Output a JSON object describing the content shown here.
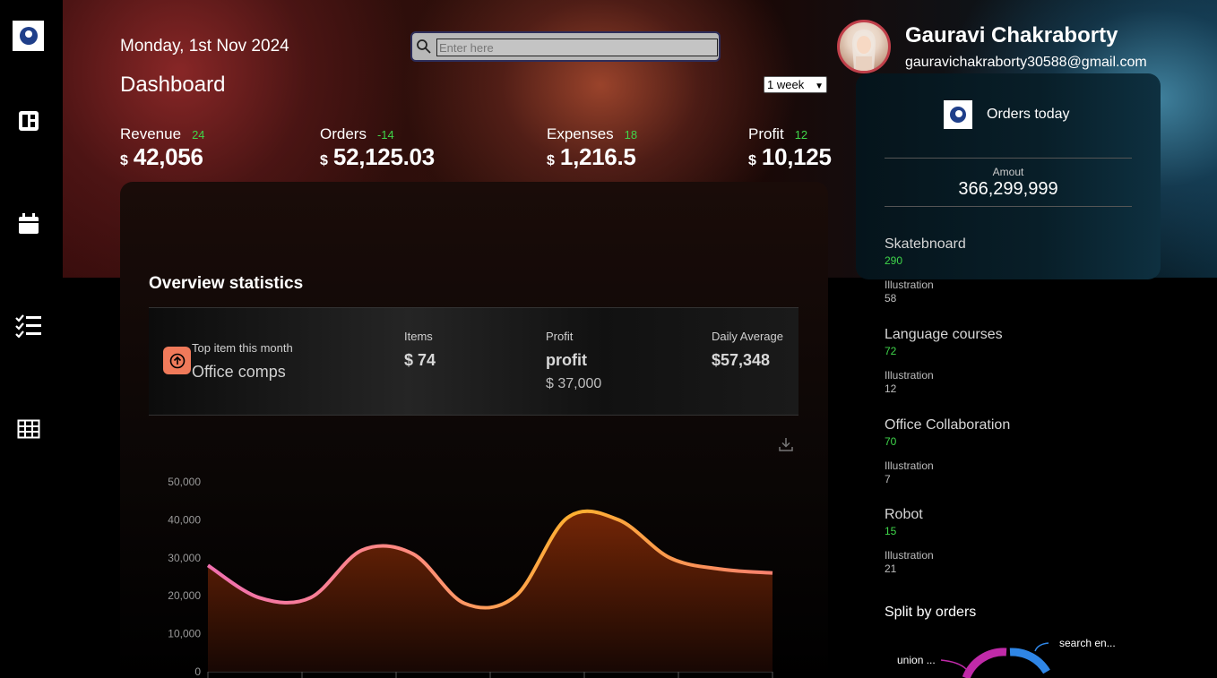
{
  "header": {
    "date": "Monday, 1st Nov 2024",
    "title": "Dashboard",
    "search_placeholder": "Enter here",
    "period": "1 week"
  },
  "sidebar": {
    "items": [
      {
        "name": "dashboard",
        "icon": "dashboard-icon"
      },
      {
        "name": "calendar",
        "icon": "calendar-icon"
      },
      {
        "name": "tasks",
        "icon": "checklist-icon"
      },
      {
        "name": "table",
        "icon": "table-icon"
      }
    ]
  },
  "metrics": [
    {
      "label": "Revenue",
      "change": "24",
      "currency": "$",
      "value": "42,056"
    },
    {
      "label": "Orders",
      "change": "-14",
      "currency": "$",
      "value": "52,125.03"
    },
    {
      "label": "Expenses",
      "change": "18",
      "currency": "$",
      "value": "1,216.5"
    },
    {
      "label": "Profit",
      "change": "12",
      "currency": "$",
      "value": "10,125"
    }
  ],
  "overview": {
    "title": "Overview statistics",
    "top_item_label": "Top item this month",
    "top_item_value": "Office comps",
    "items_label": "Items",
    "items_value": "$ 74",
    "profit_label": "Profit",
    "profit_value": "profit",
    "profit_amount": "$ 37,000",
    "avg_label": "Daily Average",
    "avg_value": "$57,348"
  },
  "chart_data": {
    "type": "area",
    "ylim": [
      0,
      50000
    ],
    "yticks": [
      "0",
      "10,000",
      "20,000",
      "30,000",
      "40,000",
      "50,000"
    ],
    "values": [
      28000,
      19500,
      19500,
      32000,
      31000,
      18000,
      20000,
      40500,
      40000,
      30000,
      27000,
      26000
    ],
    "line_gradient": [
      "#f070b0",
      "#ffb030"
    ],
    "fill_color": "#6a2408"
  },
  "user": {
    "name": "Gauravi Chakraborty",
    "email": "gauravichakraborty30588@gmail.com"
  },
  "orders_today": {
    "title": "Orders today",
    "amount_label": "Amout",
    "amount_value": "366,299,999"
  },
  "products": [
    {
      "name": "Skatebnoard",
      "count": "290",
      "sub_label": "Illustration",
      "sub_value": "58"
    },
    {
      "name": "Language courses",
      "count": "72",
      "sub_label": "Illustration",
      "sub_value": "12"
    },
    {
      "name": "Office Collaboration",
      "count": "70",
      "sub_label": "Illustration",
      "sub_value": "7"
    },
    {
      "name": "Robot",
      "count": "15",
      "sub_label": "Illustration",
      "sub_value": "21"
    }
  ],
  "split": {
    "title": "Split by orders",
    "labels": [
      "union ...",
      "search en..."
    ],
    "colors": [
      "#c02aa8",
      "#2f86e6"
    ]
  }
}
